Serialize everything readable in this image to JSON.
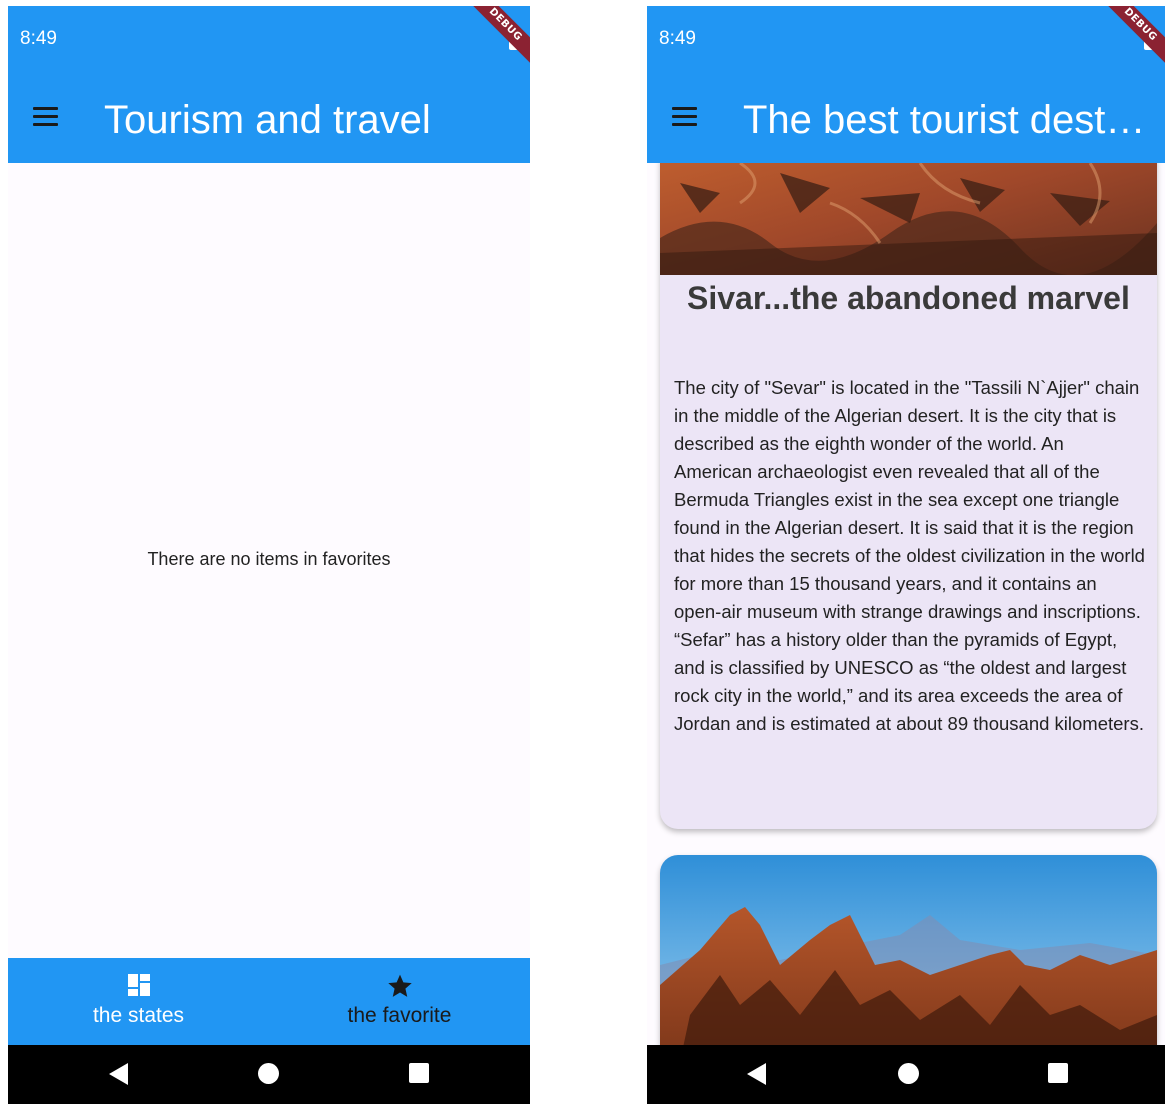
{
  "left_screen": {
    "status": {
      "time": "8:49",
      "debug_label": "DEBUG"
    },
    "app_bar": {
      "title": "Tourism and travel"
    },
    "body": {
      "empty_message": "There are no items in favorites"
    },
    "bottom_nav": {
      "items": [
        {
          "label": "the states",
          "icon": "dashboard-icon",
          "selected": true
        },
        {
          "label": "the favorite",
          "icon": "star-icon",
          "selected": false
        }
      ]
    }
  },
  "right_screen": {
    "status": {
      "time": "8:49",
      "debug_label": "DEBUG"
    },
    "app_bar": {
      "title": "The best tourist destinations"
    },
    "cards": [
      {
        "title": "Sivar...the abandoned marvel",
        "description": "The city of \"Sevar\" is located in the \"Tassili N`Ajjer\" chain in the middle of the Algerian desert. It is the city that is described as the eighth wonder of the world. An American archaeologist even revealed that all of the Bermuda Triangles exist in the sea except one triangle found in the Algerian desert. It is said that it is the region that hides the secrets of the oldest civilization in the world for more than 15 thousand years, and it contains an open-air museum with strange drawings and inscriptions. “Sefar” has a history older than the pyramids of Egypt, and is classified by UNESCO as “the oldest and largest rock city in the world,” and its area exceeds the area of Jordan and is estimated at about 89 thousand kilometers.",
        "image": "desert-rock-city-photo"
      },
      {
        "image": "hoggar-mountains-photo"
      }
    ]
  },
  "colors": {
    "primary": "#2196f3",
    "card_background": "#ece5f6",
    "page_background": "#fefbff",
    "debug_banner": "#8b2232"
  }
}
